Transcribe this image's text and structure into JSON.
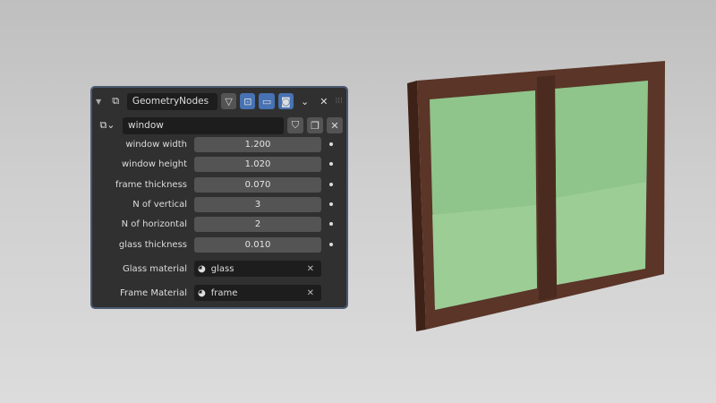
{
  "modifier": {
    "name": "GeometryNodes",
    "node_group": "window"
  },
  "inputs": [
    {
      "label": "window width",
      "value": "1.200"
    },
    {
      "label": "window height",
      "value": "1.020"
    },
    {
      "label": "frame thickness",
      "value": "0.070"
    },
    {
      "label": "N of vertical",
      "value": "3"
    },
    {
      "label": "N of horizontal",
      "value": "2"
    },
    {
      "label": "glass thickness",
      "value": "0.010"
    }
  ],
  "materials": [
    {
      "label": "Glass material",
      "value": "glass"
    },
    {
      "label": "Frame Material",
      "value": "frame"
    }
  ],
  "colors": {
    "accent": "#4772b3",
    "frame": "#5a3528",
    "glass": "#8fc48a"
  }
}
